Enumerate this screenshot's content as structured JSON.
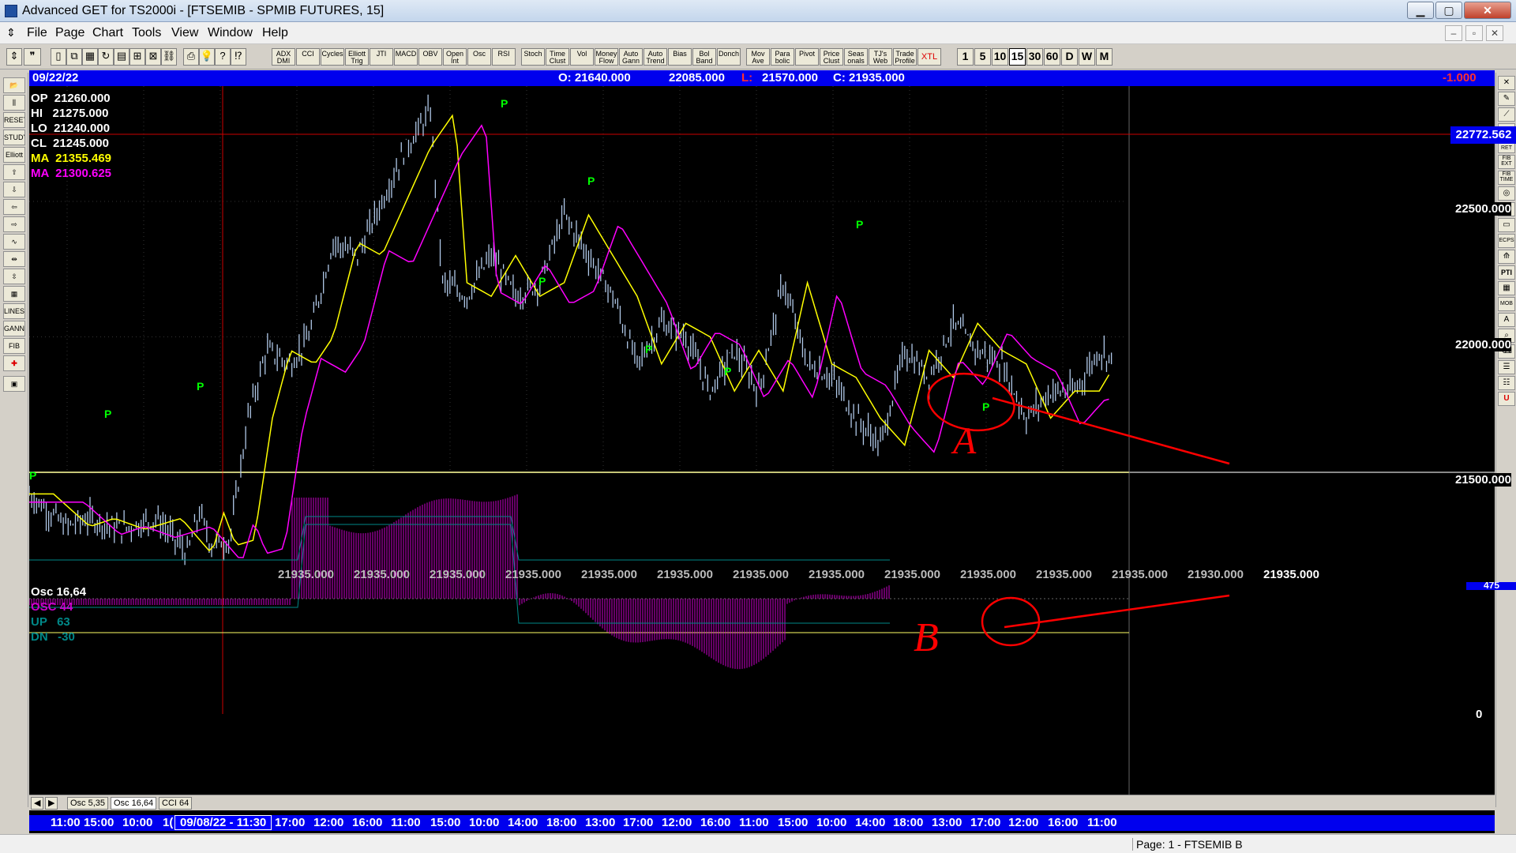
{
  "window": {
    "title": "Advanced GET for TS2000i - [FTSEMIB - SPMIB FUTURES, 15]",
    "minimize_glyph": "▁",
    "maximize_glyph": "▢",
    "close_glyph": "✕"
  },
  "menu": [
    "File",
    "Page",
    "Chart",
    "Tools",
    "View",
    "Window",
    "Help"
  ],
  "mdi": {
    "minimize": "–",
    "restore": "▫",
    "close": "✕"
  },
  "toolbar": {
    "study_buttons": [
      "ADX DMI",
      "CCI",
      "Cycles",
      "Elliott Trig",
      "JTI",
      "MACD",
      "OBV",
      "Open Int",
      "Osc",
      "RSI",
      "Stoch",
      "Time Clust",
      "Vol",
      "Money Flow",
      "Auto Gann",
      "Auto Trend",
      "Bias",
      "Bol Band",
      "Donch",
      "Mov Ave",
      "Para bolic",
      "Pivot",
      "Price Clust",
      "Seas onals",
      "TJ's Web",
      "Trade Profile",
      "XTL"
    ],
    "interval_buttons": [
      "1",
      "5",
      "10",
      "15",
      "30",
      "60",
      "D",
      "W",
      "M"
    ],
    "active_interval": "15"
  },
  "left_toolbar": [
    "RESET",
    "STUDY",
    "Elliott",
    "LINES",
    "GANN",
    "FIB"
  ],
  "right_toolbar": [
    "FIB RET",
    "FIB EXT",
    "FIB TIME",
    "ECPS",
    "PTI",
    "MOB"
  ],
  "info_bar": {
    "date": "09/22/22",
    "open": "O: 21640.000",
    "high": "22085.000",
    "low_label": "L:",
    "low": "21570.000",
    "close": "C: 21935.000",
    "change": "-1.000"
  },
  "price_legend": {
    "op": "OP  21260.000",
    "hi": "HI   21275.000",
    "lo": "LO  21240.000",
    "cl": "CL  21245.000",
    "ma1": "MA  21355.469",
    "ma2": "MA  21300.625"
  },
  "colors": {
    "bars": "#b0c8e8",
    "ma_fast": "#ffff00",
    "ma_slow": "#ff00ff",
    "pivot": "#00ff00",
    "annotation": "#ff0000",
    "osc_hist": "#cc00cc",
    "osc_band": "#008888",
    "info_bar": "#0000ee"
  },
  "price_axis": [
    "22500.000",
    "22000.000",
    "21500.000"
  ],
  "price_highlight": "22772.562",
  "pivot_glyph": "P",
  "bottom_values": [
    "21935.000",
    "21935.000",
    "21935.000",
    "21935.000",
    "21935.000",
    "21935.000",
    "21935.000",
    "21935.000",
    "21935.000",
    "21935.000",
    "21935.000",
    "21935.000",
    "21930.000",
    "21935.000"
  ],
  "annotations": {
    "a": "A",
    "b": "B"
  },
  "oscillator": {
    "title": "Osc 16,64",
    "osc": "OSC 44",
    "up": "UP   63",
    "dn": "DN   -30",
    "axis_top": "475",
    "axis_zero": "0"
  },
  "tabs": [
    "Osc 5,35",
    "Osc 16,64",
    "CCI 64"
  ],
  "active_tab": "Osc 16,64",
  "tab_nav": [
    "◀",
    "▶"
  ],
  "time_axis": [
    "11:00",
    "15:00",
    "10:00",
    "1(",
    "09/08/22 - 11:30",
    "17:00",
    "12:00",
    "16:00",
    "11:00",
    "15:00",
    "10:00",
    "14:00",
    "18:00",
    "13:00",
    "17:00",
    "12:00",
    "16:00",
    "11:00",
    "15:00",
    "10:00",
    "14:00",
    "18:00",
    "13:00",
    "17:00",
    "12:00",
    "16:00",
    "11:00"
  ],
  "status": {
    "page": "Page: 1 - FTSEMIB B"
  }
}
